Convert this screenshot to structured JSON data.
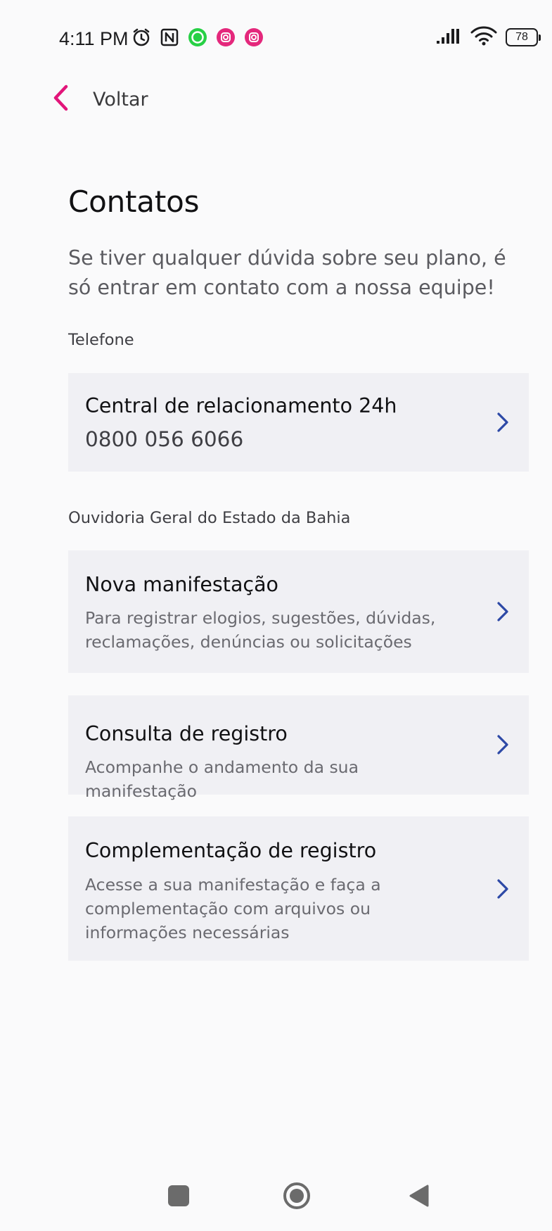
{
  "status_bar": {
    "time": "4:11 PM",
    "battery": "78",
    "left_icons": [
      "alarm-icon",
      "nfc-icon",
      "whatsapp-icon",
      "instagram-icon",
      "instagram-icon"
    ],
    "right_icons": [
      "signal-icon",
      "wifi-icon",
      "battery-icon"
    ]
  },
  "header": {
    "back_label": "Voltar",
    "back_icon": "chevron-left-icon",
    "accent_color": "#e2157a"
  },
  "page": {
    "title": "Contatos",
    "subtitle": "Se tiver qualquer dúvida sobre seu plano, é só entrar em contato com a nossa equipe!"
  },
  "sections": {
    "phone": {
      "label": "Telefone",
      "card": {
        "title": "Central de relacionamento 24h",
        "phone": "0800 056 6066"
      }
    },
    "ombudsman": {
      "label": "Ouvidoria Geral do Estado da Bahia",
      "cards": [
        {
          "title": "Nova manifestação",
          "description": "Para registrar elogios, sugestões, dúvidas, reclamações, denúncias ou solicitações"
        },
        {
          "title": "Consulta de registro",
          "description": "Acompanhe o andamento da sua manifestação"
        },
        {
          "title": "Complementação de registro",
          "description": "Acesse a sua manifestação e faça a complementação com arquivos ou informações necessárias"
        }
      ]
    }
  },
  "colors": {
    "chevron": "#2d49a6",
    "card_background": "#f0f0f4",
    "page_background": "#fafafb"
  },
  "nav_bar": {
    "icons": [
      "recent-apps-icon",
      "home-icon",
      "back-triangle-icon"
    ]
  }
}
